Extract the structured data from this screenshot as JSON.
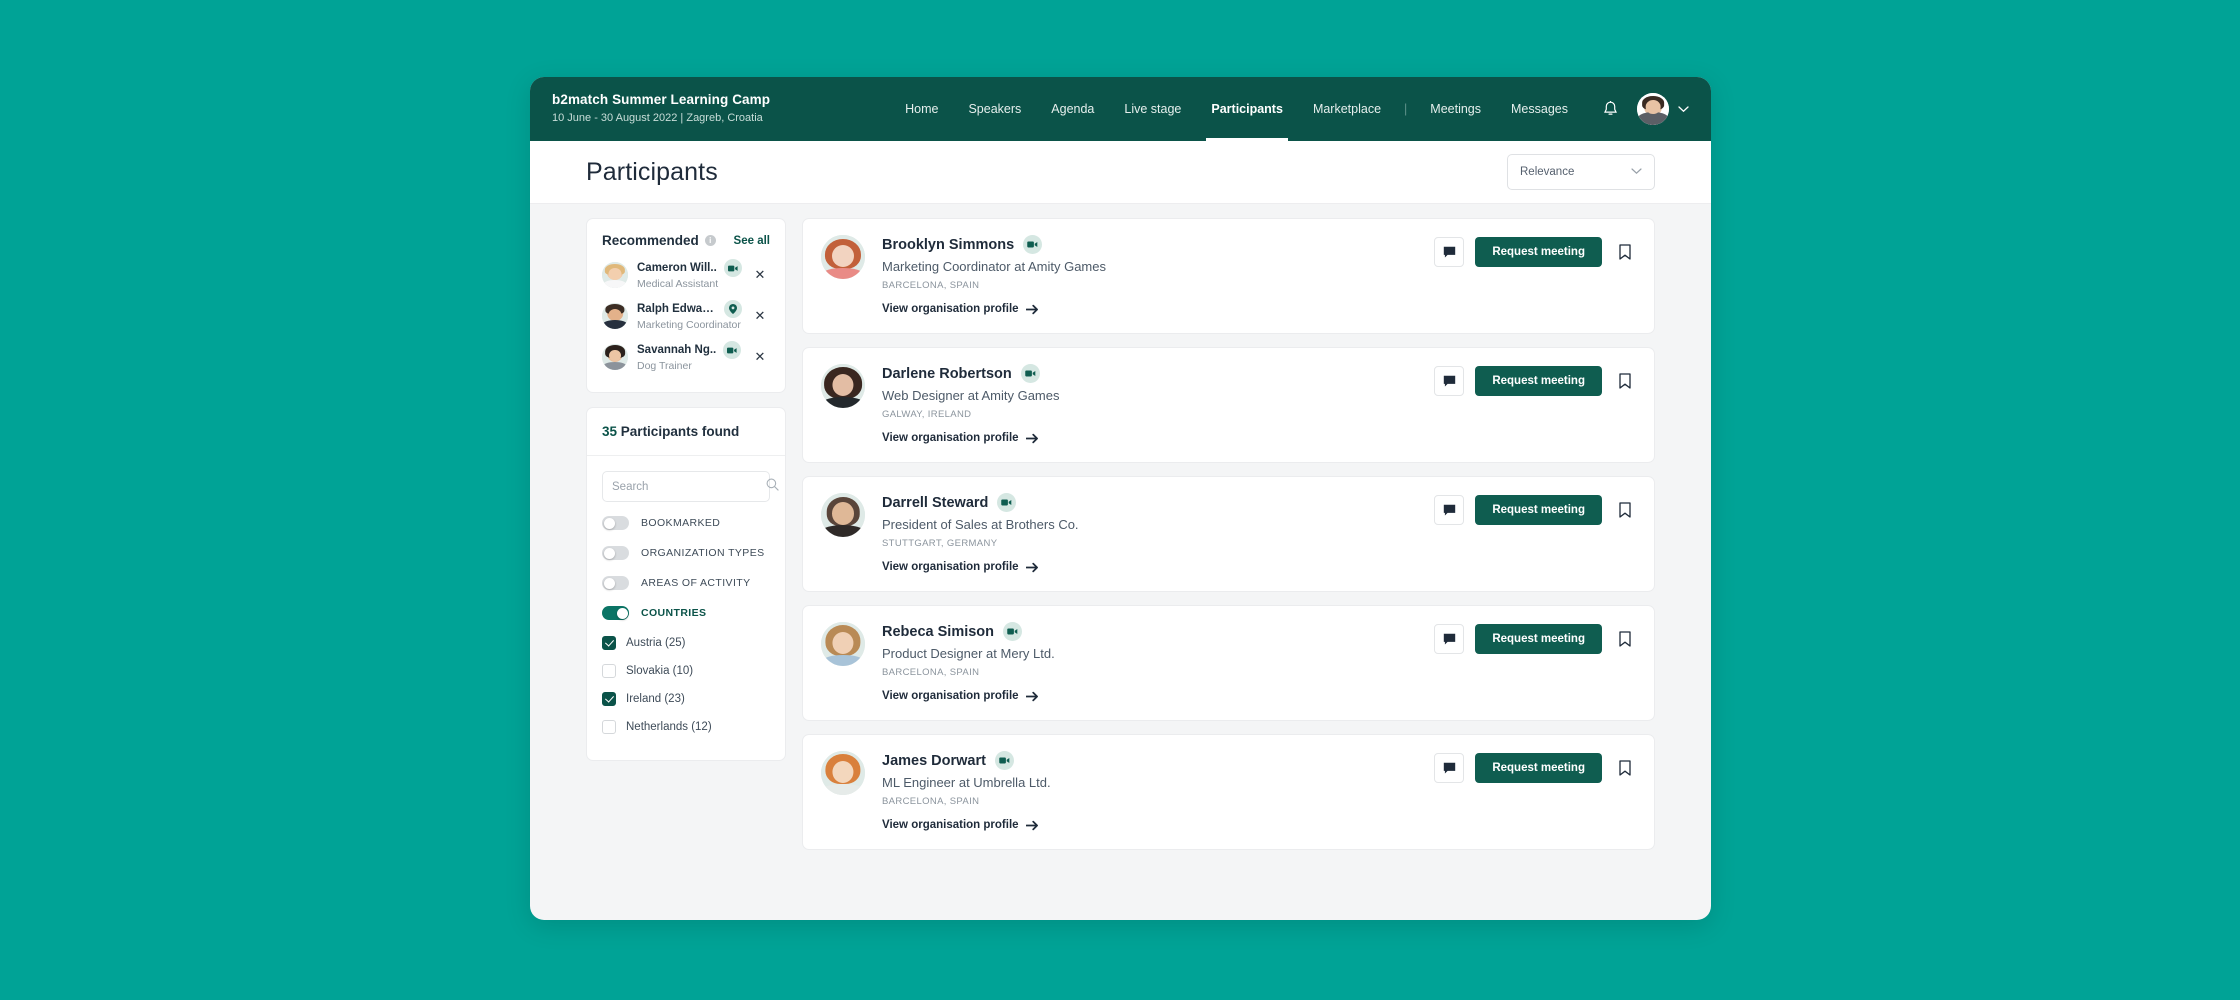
{
  "theme": {
    "page_bg": "#00A396",
    "header_bg": "#0B5349",
    "accent_dark": "#0F5D50",
    "accent_toggle": "#0B7465",
    "surface": "#FFFFFF",
    "app_bg": "#F4F5F6"
  },
  "header": {
    "event_title": "b2match Summer Learning Camp",
    "event_subtitle": "10 June - 30 August 2022 | Zagreb, Croatia",
    "nav": [
      {
        "label": "Home",
        "active": false
      },
      {
        "label": "Speakers",
        "active": false
      },
      {
        "label": "Agenda",
        "active": false
      },
      {
        "label": "Live stage",
        "active": false
      },
      {
        "label": "Participants",
        "active": true
      },
      {
        "label": "Marketplace",
        "active": false
      }
    ],
    "separator": "|",
    "nav_right": [
      {
        "label": "Meetings"
      },
      {
        "label": "Messages"
      }
    ],
    "bell_icon": "bell-icon",
    "avatar_icon": "user-avatar",
    "chevron_icon": "chevron-down-icon"
  },
  "page": {
    "title": "Participants",
    "sort": {
      "selected": "Relevance",
      "chevron_icon": "chevron-down-icon"
    }
  },
  "recommended": {
    "title": "Recommended",
    "info_icon": "info-icon",
    "info_glyph": "i",
    "see_all": "See all",
    "items": [
      {
        "name": "Cameron Will..",
        "role": "Medical Assistant",
        "badge": "video-icon",
        "close_icon": "close-icon",
        "close_glyph": "✕"
      },
      {
        "name": "Ralph Edwards",
        "role": "Marketing Coordinator",
        "badge": "location-pin-icon",
        "close_icon": "close-icon",
        "close_glyph": "✕"
      },
      {
        "name": "Savannah Ng..",
        "role": "Dog Trainer",
        "badge": "video-icon",
        "close_icon": "close-icon",
        "close_glyph": "✕"
      }
    ]
  },
  "filters": {
    "count": "35",
    "found_label": "Participants found",
    "search": {
      "value": "",
      "placeholder": "Search",
      "icon": "search-icon"
    },
    "toggles": [
      {
        "label": "BOOKMARKED",
        "on": false
      },
      {
        "label": "ORGANIZATION TYPES",
        "on": false
      },
      {
        "label": "AREAS OF ACTIVITY",
        "on": false
      },
      {
        "label": "COUNTRIES",
        "on": true
      }
    ],
    "countries": [
      {
        "label": "Austria (25)",
        "checked": true
      },
      {
        "label": "Slovakia (10)",
        "checked": false
      },
      {
        "label": "Ireland (23)",
        "checked": true
      },
      {
        "label": "Netherlands (12)",
        "checked": false
      }
    ]
  },
  "participants": {
    "action_labels": {
      "request_meeting": "Request meeting",
      "chat_icon": "chat-bubble-icon",
      "bookmark_icon": "bookmark-icon",
      "view_profile": "View organisation profile",
      "arrow_icon": "arrow-right-icon"
    },
    "list": [
      {
        "name": "Brooklyn Simmons",
        "role": "Marketing Coordinator at Amity Games",
        "location": "BARCELONA, SPAIN",
        "badge": "video-icon",
        "link": "View organisation profile",
        "button": "Request meeting",
        "avatar_colors": [
          "#e8a078",
          "#c2603a",
          "#f2d3c0"
        ]
      },
      {
        "name": "Darlene Robertson",
        "role": "Web Designer at Amity Games",
        "location": "GALWAY, IRELAND",
        "badge": "video-icon",
        "link": "View organisation profile",
        "button": "Request meeting",
        "avatar_colors": [
          "#6b4a3c",
          "#3a2720",
          "#e3bda4"
        ]
      },
      {
        "name": "Darrell Steward",
        "role": "President of Sales at Brothers Co.",
        "location": "STUTTGART, GERMANY",
        "badge": "video-icon",
        "link": "View organisation profile",
        "button": "Request meeting",
        "avatar_colors": [
          "#8a6b52",
          "#2f2a28",
          "#dfb897"
        ]
      },
      {
        "name": "Rebeca Simison",
        "role": "Product Designer at Mery Ltd.",
        "location": "BARCELONA, SPAIN",
        "badge": "video-icon",
        "link": "View organisation profile",
        "button": "Request meeting",
        "avatar_colors": [
          "#d9a870",
          "#9a6f3e",
          "#f0d0b5"
        ]
      },
      {
        "name": "James Dorwart",
        "role": "ML Engineer at Umbrella Ltd.",
        "location": "BARCELONA, SPAIN",
        "badge": "video-icon",
        "link": "View organisation profile",
        "button": "Request meeting",
        "avatar_colors": [
          "#d98b4a",
          "#b05f28",
          "#f3d7bd"
        ]
      }
    ]
  }
}
